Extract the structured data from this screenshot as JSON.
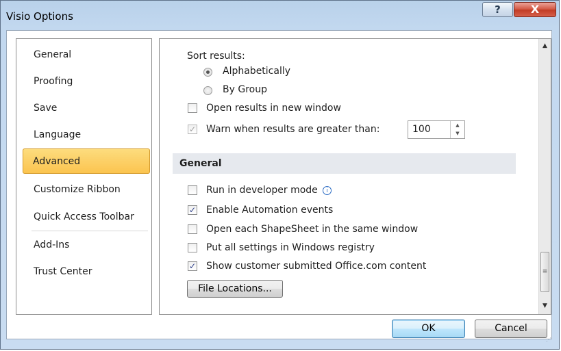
{
  "window": {
    "title": "Visio Options",
    "help_glyph": "?",
    "close_glyph": "X"
  },
  "nav": {
    "items": [
      {
        "label": "General"
      },
      {
        "label": "Proofing"
      },
      {
        "label": "Save"
      },
      {
        "label": "Language"
      },
      {
        "label": "Advanced",
        "selected": true
      },
      {
        "label": "Customize Ribbon"
      },
      {
        "label": "Quick Access Toolbar"
      },
      {
        "label": "Add-Ins"
      },
      {
        "label": "Trust Center"
      }
    ]
  },
  "content": {
    "sort_results_label": "Sort results:",
    "sort_options": [
      {
        "label": "Alphabetically",
        "checked": true
      },
      {
        "label": "By Group",
        "checked": false
      }
    ],
    "open_results_new_window": {
      "label": "Open results in new window",
      "checked": false
    },
    "warn_results": {
      "label": "Warn when results are greater than:",
      "checked": true,
      "value": "100"
    },
    "general_section": "General",
    "options": [
      {
        "label": "Run in developer mode",
        "checked": false
      },
      {
        "label": "Enable Automation events",
        "checked": true
      },
      {
        "label": "Open each ShapeSheet in the same window",
        "checked": false
      },
      {
        "label": "Put all settings in Windows registry",
        "checked": false
      },
      {
        "label": "Show customer submitted Office.com content",
        "checked": true
      }
    ],
    "file_locations_label": "File Locations...",
    "info_glyph": "i"
  },
  "footer": {
    "ok_label": "OK",
    "cancel_label": "Cancel"
  },
  "colors": {
    "selected_nav_bg": "#fbc44f",
    "section_header_bg": "#e6e9ee",
    "check_color": "#2d3f89"
  }
}
